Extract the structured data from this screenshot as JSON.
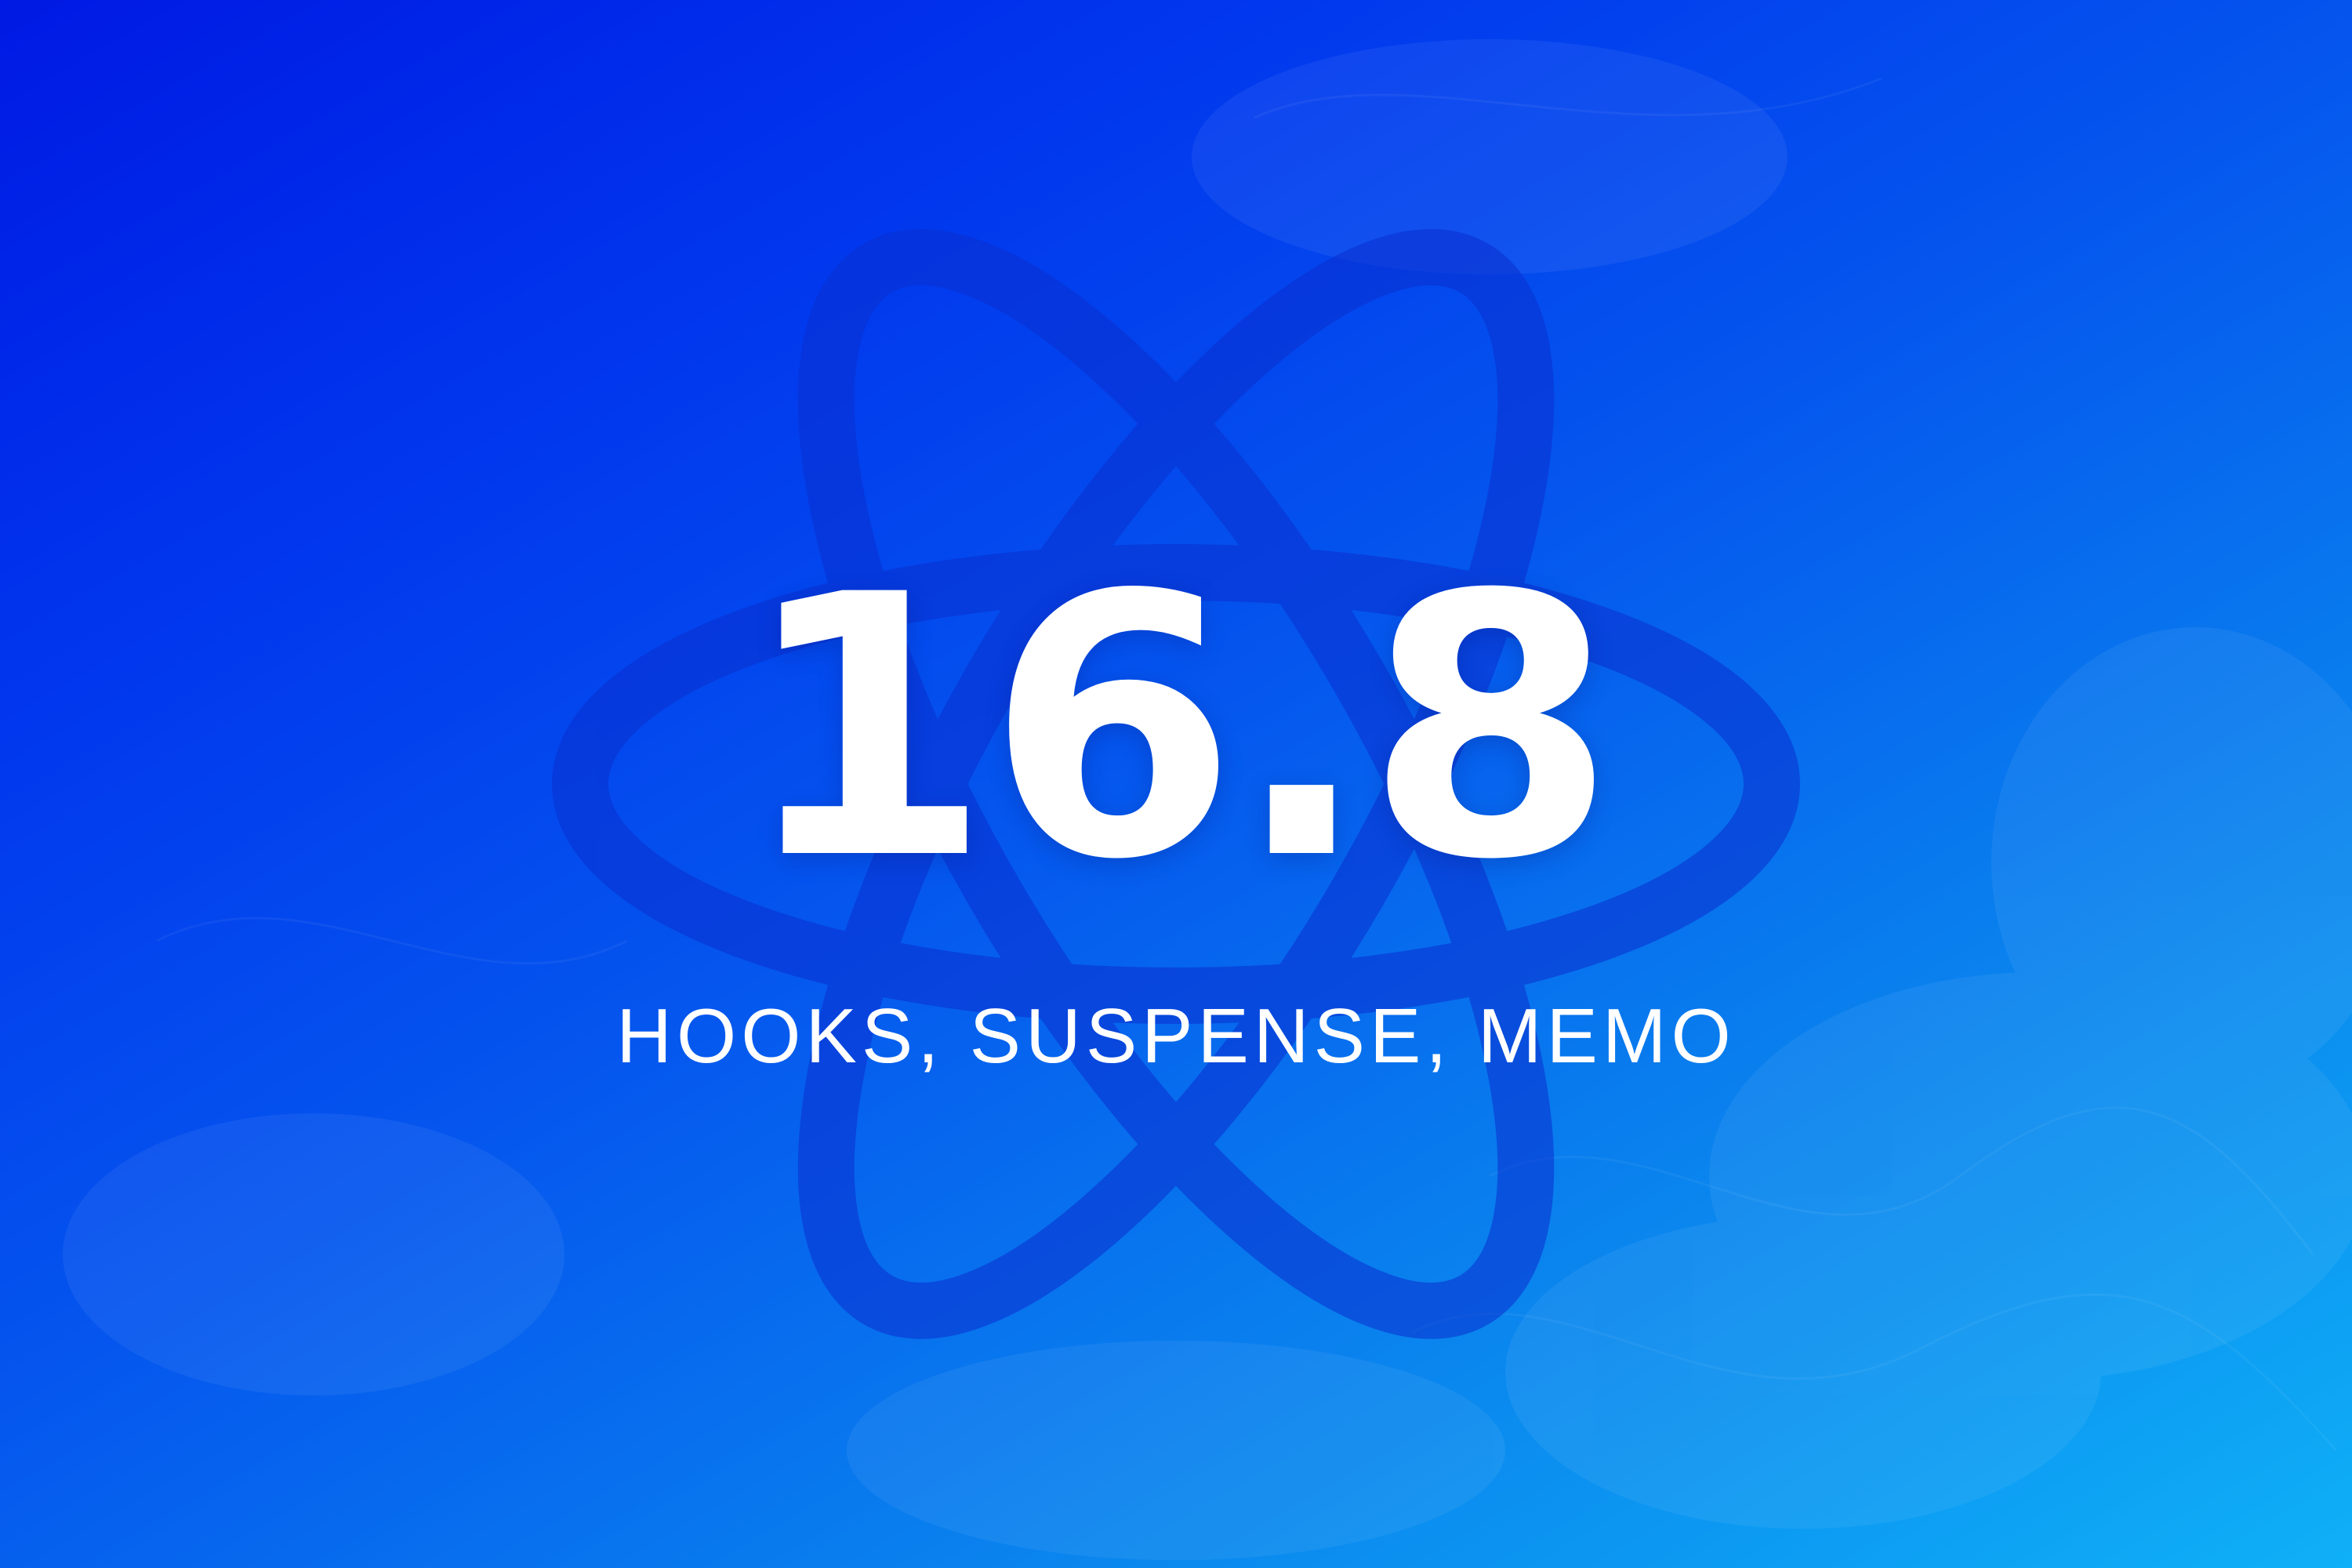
{
  "banner": {
    "version": "16.8",
    "subtitle": "HOOKS, SUSPENSE, MEMO"
  },
  "icons": {
    "logo": "react-atom-icon"
  },
  "colors": {
    "gradient_start": "#0019e4",
    "gradient_end": "#0fb0f7",
    "logo_outline": "#0a2fd0",
    "text": "#ffffff"
  }
}
